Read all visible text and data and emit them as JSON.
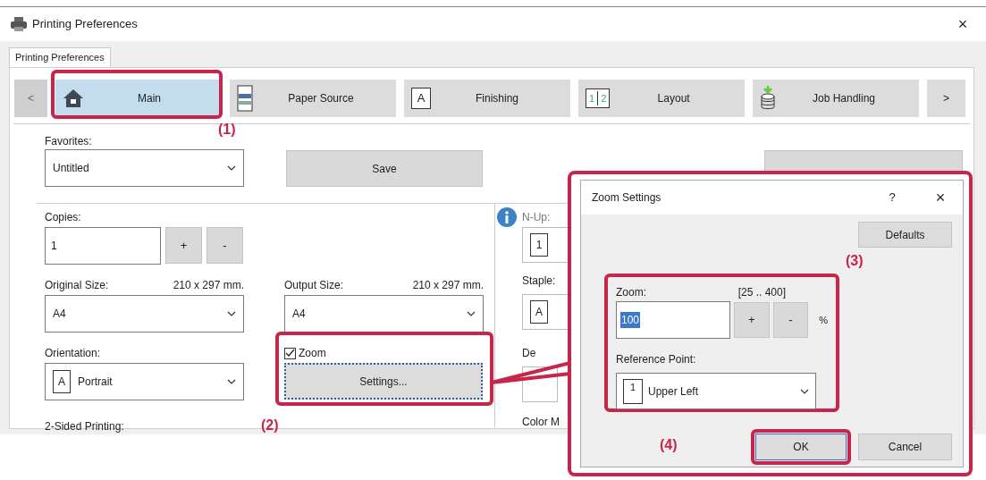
{
  "window": {
    "title": "Printing Preferences",
    "close": "×"
  },
  "sheet_tab": {
    "label": "Printing Preferences",
    "selected": true
  },
  "nav": {
    "prev": {
      "label": "<",
      "disabled": true
    },
    "next": {
      "label": ">",
      "disabled": false
    },
    "tabs": [
      {
        "label": "Main",
        "kind": "home",
        "selected": true
      },
      {
        "label": "Paper Source",
        "kind": "paper",
        "selected": false
      },
      {
        "label": "Finishing",
        "kind": "finishing",
        "glyph": "A",
        "selected": false
      },
      {
        "label": "Layout",
        "kind": "layout",
        "glyph": "1",
        "glyph_2": "2",
        "selected": false
      },
      {
        "label": "Job Handling",
        "kind": "job",
        "selected": false
      }
    ]
  },
  "favorites": {
    "label": "Favorites:",
    "value": "Untitled",
    "save": "Save"
  },
  "copies": {
    "label": "Copies:",
    "value": "1",
    "plus": "+",
    "minus": "-"
  },
  "original_size": {
    "label": "Original Size:",
    "dimensions": "210 x 297 mm.",
    "value": "A4"
  },
  "output_size": {
    "label": "Output Size:",
    "dimensions": "210 x 297 mm.",
    "value": "A4"
  },
  "orientation": {
    "label": "Orientation:",
    "glyph": "A",
    "value": "Portrait"
  },
  "zoom": {
    "label": "Zoom",
    "checked": true,
    "settings": "Settings..."
  },
  "two_sided": {
    "label": "2-Sided Printing:"
  },
  "right_column": {
    "n_up": {
      "label": "N-Up:",
      "glyph": "1"
    },
    "staple": {
      "label": "Staple:",
      "glyph": "A"
    },
    "label_3": "De",
    "label_4": "Color M"
  },
  "zoom_dialog": {
    "title": "Zoom Settings",
    "help": "?",
    "close": "×",
    "defaults": "Defaults",
    "zoom_label": "Zoom:",
    "range": "[25 .. 400]",
    "value": "100",
    "plus": "+",
    "minus": "-",
    "unit": "%",
    "reference_label": "Reference Point:",
    "reference_glyph": "1",
    "reference_value": "Upper Left",
    "ok": "OK",
    "cancel": "Cancel"
  },
  "annotations": [
    {
      "label": "(1)"
    },
    {
      "label": "(2)"
    },
    {
      "label": "(3)"
    },
    {
      "label": "(4)"
    }
  ]
}
